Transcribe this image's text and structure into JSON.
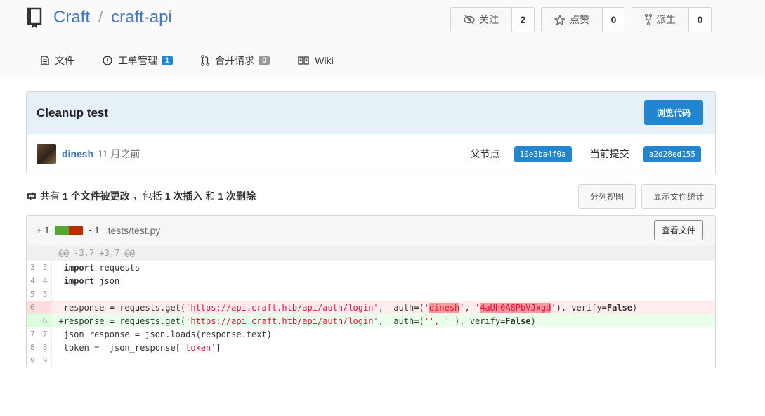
{
  "repo": {
    "owner": "Craft",
    "separator": "/",
    "name": "craft-api"
  },
  "actions": [
    {
      "label": "关注",
      "count": "2",
      "icon": "eye-slash-icon"
    },
    {
      "label": "点赞",
      "count": "0",
      "icon": "star-icon"
    },
    {
      "label": "派生",
      "count": "0",
      "icon": "fork-icon"
    }
  ],
  "tabs": [
    {
      "label": "文件",
      "icon": "file-icon"
    },
    {
      "label": "工单管理",
      "badge": "1",
      "icon": "issue-icon"
    },
    {
      "label": "合并请求",
      "badge": "0",
      "icon": "pull-request-icon"
    },
    {
      "label": "Wiki",
      "icon": "book-icon"
    }
  ],
  "commit": {
    "title": "Cleanup test",
    "browse_label": "浏览代码",
    "author": "dinesh",
    "time": "11 月之前",
    "parent_label": "父节点",
    "parent_sha": "10e3ba4f0a",
    "current_label": "当前提交",
    "current_sha": "a2d28ed155"
  },
  "stats": {
    "prefix": "共有",
    "files": "1 个文件被更改",
    "mid": "，包括",
    "additions": "1 次插入",
    "and": "和",
    "deletions": "1 次删除",
    "split_view_label": "分列视图",
    "show_stats_label": "显示文件统计"
  },
  "diff": {
    "additions": "+ 1",
    "deletions": "- 1",
    "filename": "tests/test.py",
    "view_file_label": "查看文件",
    "hunk": "@@ -3,7 +3,7 @@",
    "lines": {
      "l1": {
        "old": "3",
        "new": "3"
      },
      "l2": {
        "old": "4",
        "new": "4"
      },
      "l3": {
        "old": "5",
        "new": "5"
      },
      "l4": {
        "old": "6",
        "new": ""
      },
      "l5": {
        "old": "",
        "new": "6"
      },
      "l6": {
        "old": "7",
        "new": "7"
      },
      "l7": {
        "old": "8",
        "new": "8"
      },
      "l8": {
        "old": "9",
        "new": "9"
      }
    },
    "code": {
      "import_kw": "import",
      "requests": "requests",
      "json": "json",
      "del_prefix": "-response = requests.get(",
      "add_prefix": "+response = requests.get(",
      "url": "'https://api.craft.htb/api/auth/login'",
      "auth_open": ",  auth=(",
      "q": "'",
      "user": "dinesh",
      "comma": ", ",
      "password": "4aUh0A8PbVJxgd",
      "close": "), verify=",
      "false_kw": "False",
      "paren": ")",
      "empty_creds": "'', ''",
      "json_response": " json_response = json.loads(response.text)",
      "token_line": " token =  json_response[",
      "token_key": "'token'",
      "bracket": "]"
    }
  },
  "colors": {
    "accent": "#2185d0",
    "link": "#4078c0",
    "add_bar": "#55a532",
    "del_bar": "#bd2c00"
  }
}
